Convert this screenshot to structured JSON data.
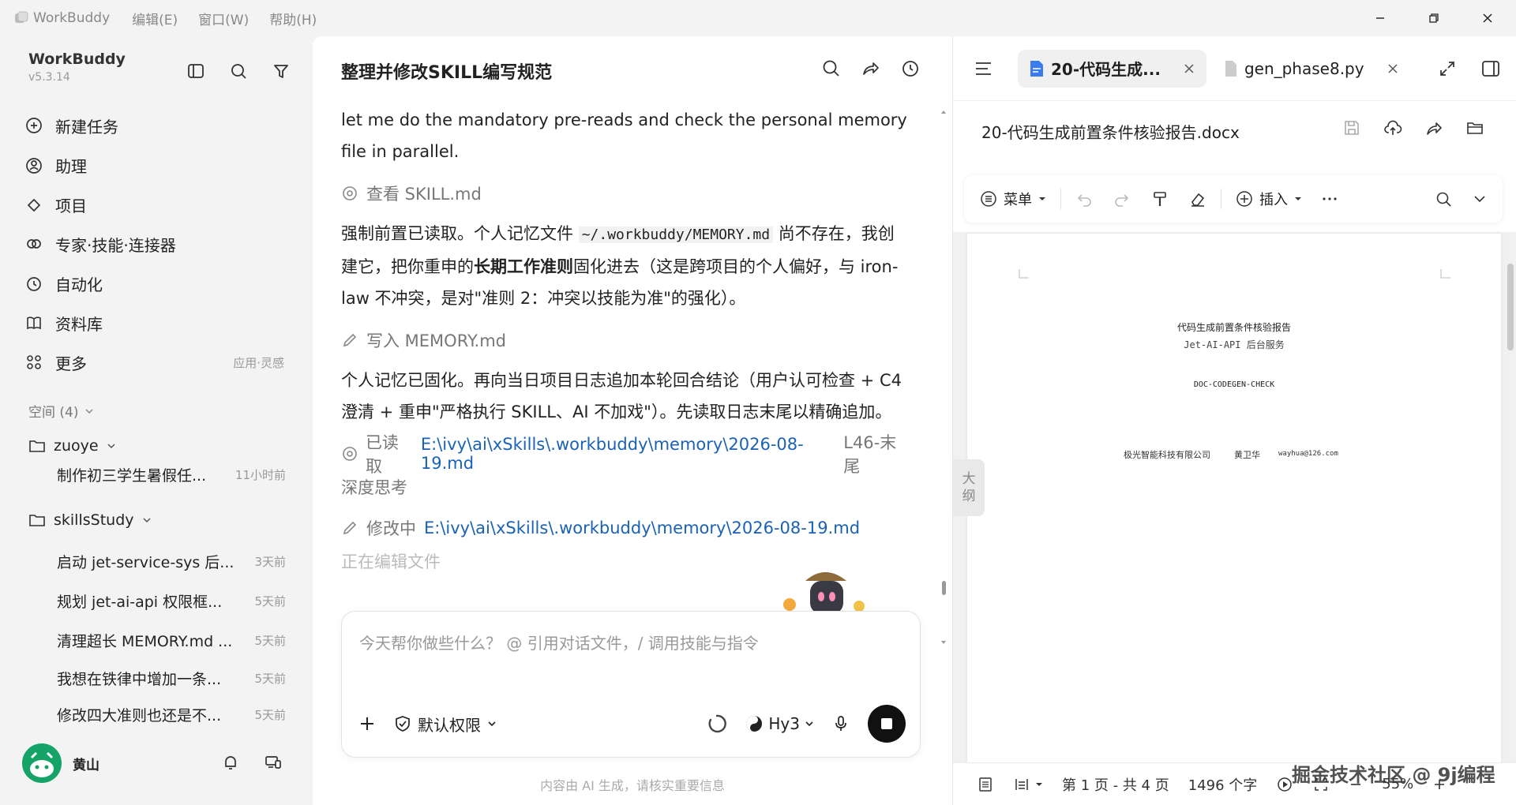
{
  "titlebar": {
    "app": "WorkBuddy",
    "menus": [
      "编辑(E)",
      "窗口(W)",
      "帮助(H)"
    ]
  },
  "sidebar": {
    "brand": "WorkBuddy",
    "version": "v5.3.14",
    "nav": [
      {
        "label": "新建任务",
        "icon": "plus-circle-icon"
      },
      {
        "label": "助理",
        "icon": "assistant-icon"
      },
      {
        "label": "项目",
        "icon": "project-icon"
      },
      {
        "label": "专家·技能·连接器",
        "icon": "expert-icon"
      },
      {
        "label": "自动化",
        "icon": "alarm-icon"
      },
      {
        "label": "资料库",
        "icon": "book-icon"
      },
      {
        "label": "更多",
        "icon": "grid-icon",
        "extra": "应用·灵感"
      }
    ],
    "space_label": "空间 (4)",
    "projects": [
      {
        "name": "zuoye",
        "tasks": [
          {
            "title": "制作初三学生暑假任...",
            "time": "11小时前"
          }
        ]
      },
      {
        "name": "skillsStudy",
        "tasks": [
          {
            "title": "启动 jet-service-sys 后...",
            "time": "3天前"
          },
          {
            "title": "规划 jet-ai-api 权限框...",
            "time": "5天前"
          },
          {
            "title": "清理超长 MEMORY.md ...",
            "time": "5天前"
          },
          {
            "title": "我想在铁律中增加一条...",
            "time": "5天前"
          },
          {
            "title": "修改四大准则也还是不...",
            "time": "5天前"
          }
        ]
      }
    ],
    "user": "黄山"
  },
  "chat": {
    "title": "整理并修改SKILL编写规范",
    "msg1": "let me do the mandatory pre-reads and check the personal memory file in parallel.",
    "step1": "查看 SKILL.md",
    "msg2_a": "强制前置已读取。个人记忆文件 ",
    "msg2_code": "~/.workbuddy/MEMORY.md",
    "msg2_b": " 尚不存在，我创建它，把你重申的",
    "msg2_bold": "长期工作准则",
    "msg2_c": "固化进去（这是跨项目的个人偏好，与 iron-law 不冲突，是对\"准则 2：冲突以技能为准\"的强化）。",
    "step2": "写入 MEMORY.md",
    "msg3": "个人记忆已固化。再向当日项目日志追加本轮回合结论（用户认可检查 + C4 澄清 + 重申\"严格执行 SKILL、AI 不加戏\"）。先读取日志末尾以精确追加。",
    "step3_label": "已读取",
    "step3_link": "E:\\ivy\\ai\\xSkills\\.workbuddy\\memory\\2026-08-19.md",
    "step3_suffix": "L46-末尾",
    "thinking": "深度思考",
    "step4_label": "修改中",
    "step4_link": "E:\\ivy\\ai\\xSkills\\.workbuddy\\memory\\2026-08-19.md",
    "editing": "正在编辑文件",
    "placeholder": "今天帮你做些什么？ @ 引用对话文件，/ 调用技能与指令",
    "permission": "默认权限",
    "model": "Hy3",
    "disclaimer": "内容由 AI 生成，请核实重要信息"
  },
  "doc": {
    "tab_active": "20-代码生成...",
    "tab_other": "gen_phase8.py",
    "filename": "20-代码生成前置条件核验报告.docx",
    "toolbar": {
      "menu": "菜单",
      "insert": "插入"
    },
    "page": {
      "title": "代码生成前置条件核验报告",
      "subtitle": "Jet-AI-API 后台服务",
      "code": "DOC-CODEGEN-CHECK",
      "company": "极光智能科技有限公司",
      "author": "黄卫华",
      "email": "wayhua@126.com"
    },
    "outline": [
      "大",
      "纲"
    ],
    "status": {
      "page": "第 1 页 - 共 4 页",
      "words": "1496 个字",
      "zoom": "55%"
    }
  },
  "watermark": "掘金技术社区 @ 9j编程"
}
